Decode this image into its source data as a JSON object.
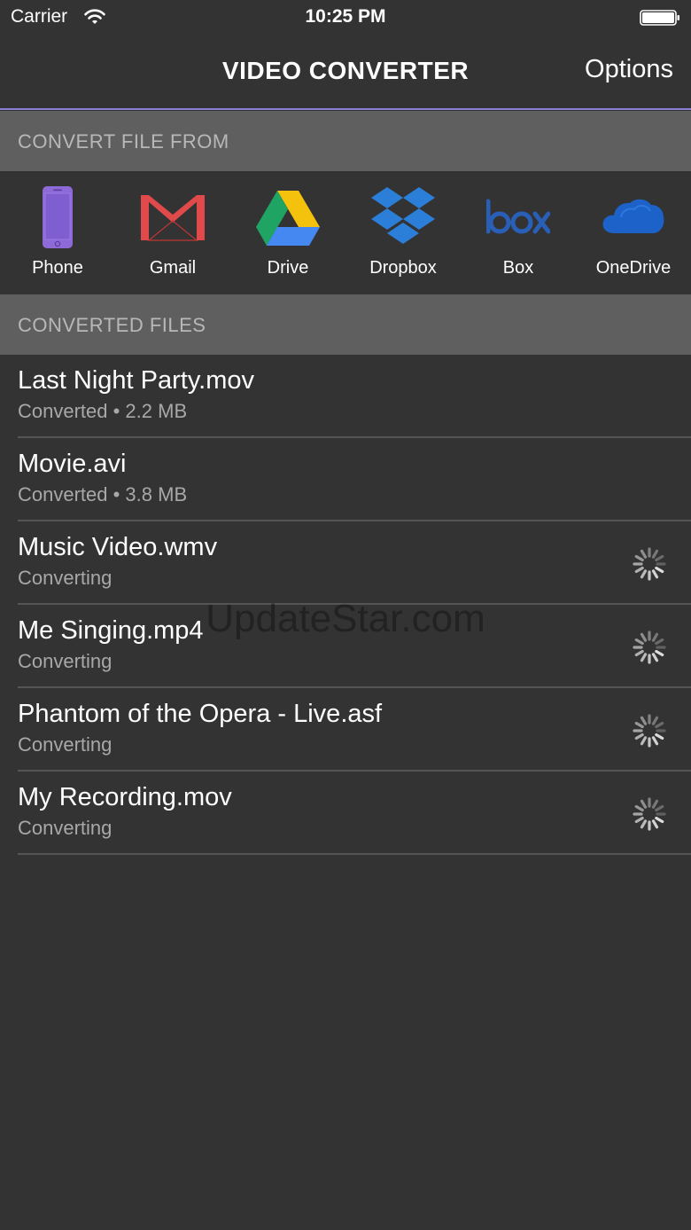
{
  "status_bar": {
    "carrier": "Carrier",
    "time": "10:25 PM"
  },
  "nav": {
    "title": "VIDEO CONVERTER",
    "options_label": "Options"
  },
  "section_convert_from": "CONVERT FILE FROM",
  "section_converted": "CONVERTED FILES",
  "sources": [
    {
      "label": "Phone",
      "icon": "phone-icon"
    },
    {
      "label": "Gmail",
      "icon": "gmail-icon"
    },
    {
      "label": "Drive",
      "icon": "google-drive-icon"
    },
    {
      "label": "Dropbox",
      "icon": "dropbox-icon"
    },
    {
      "label": "Box",
      "icon": "box-icon"
    },
    {
      "label": "OneDrive",
      "icon": "onedrive-icon"
    }
  ],
  "files": [
    {
      "name": "Last Night Party.mov",
      "status": "Converted • 2.2 MB",
      "converting": false
    },
    {
      "name": "Movie.avi",
      "status": "Converted • 3.8 MB",
      "converting": false
    },
    {
      "name": "Music Video.wmv",
      "status": "Converting",
      "converting": true
    },
    {
      "name": "Me Singing.mp4",
      "status": "Converting",
      "converting": true
    },
    {
      "name": "Phantom of the Opera - Live.asf",
      "status": "Converting",
      "converting": true
    },
    {
      "name": "My Recording.mov",
      "status": "Converting",
      "converting": true
    }
  ],
  "watermark": "UpdateStar.com",
  "colors": {
    "background": "#333333",
    "section_header": "#5f5f5f",
    "nav_accent": "#8a7fd6"
  }
}
